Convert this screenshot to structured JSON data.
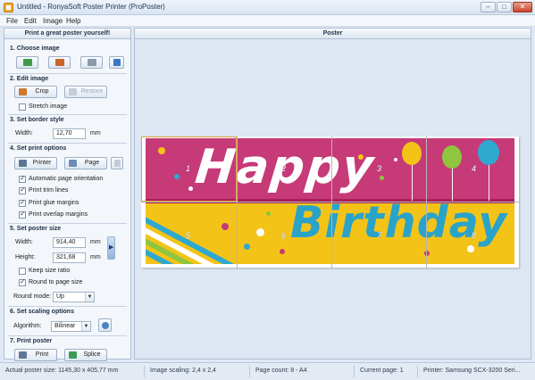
{
  "window": {
    "title": "Untitled - RonyaSoft Poster Printer (ProPoster)"
  },
  "menu": [
    "File",
    "Edit",
    "Image",
    "Help"
  ],
  "left_panel": {
    "header": "Print a great poster yourself!",
    "sections": {
      "choose_image": "1. Choose image",
      "edit_image": "2. Edit image",
      "border_style": "3. Set border style",
      "print_options": "4. Set print options",
      "poster_size": "5. Set poster size",
      "scaling": "6. Set scaling options",
      "print_poster": "7. Print poster"
    },
    "edit": {
      "crop": "Crop",
      "restore": "Restore",
      "stretch_image": "Stretch image"
    },
    "border": {
      "width_label": "Width:",
      "width_value": "12,70",
      "unit": "mm"
    },
    "print_options": {
      "printer": "Printer",
      "page": "Page",
      "auto_orientation": "Automatic page orientation",
      "trim_lines": "Print trim lines",
      "glue_margins": "Print glue margins",
      "overlap_margins": "Print overlap margins"
    },
    "poster_size": {
      "width_label": "Width:",
      "width_value": "914,40",
      "height_label": "Height:",
      "height_value": "321,68",
      "unit": "mm",
      "keep_ratio": "Keep size ratio",
      "round_to_page": "Round to page size",
      "round_mode_label": "Round mode:",
      "round_mode_value": "Up"
    },
    "scaling": {
      "algorithm_label": "Algorithm:",
      "algorithm_value": "Bilinear"
    },
    "print": {
      "print": "Print",
      "splice": "Splice"
    }
  },
  "right_panel": {
    "header": "Poster",
    "poster_text": {
      "line1": "Happy",
      "line2": "Birthday"
    },
    "page_numbers": [
      "1",
      "2",
      "3",
      "4",
      "5",
      "6",
      "7",
      "8"
    ]
  },
  "status": {
    "actual_size": "Actual poster size: 1145,30 x 405,77 mm",
    "image_scaling": "Image scaling: 2,4 x 2,4",
    "page_count": "Page count: 8 - A4",
    "current_page": "Current page: 1",
    "printer": "Printer: Samsung SCX-3200 Seri..."
  },
  "colors": {
    "poster_pink": "#c63a78",
    "poster_yellow": "#f4c318",
    "poster_blue_text": "#2aa3c9",
    "accent_border": "#aebed3"
  }
}
